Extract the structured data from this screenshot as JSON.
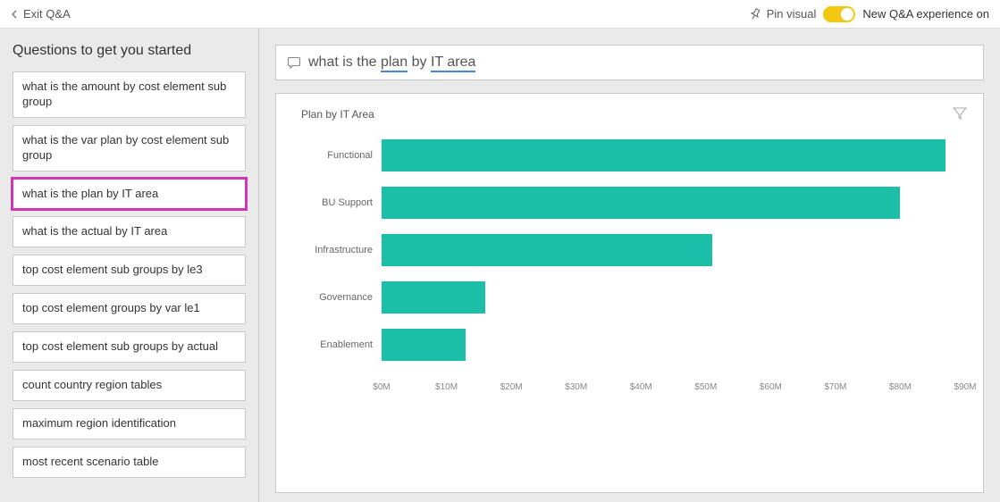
{
  "topbar": {
    "exit_label": "Exit Q&A",
    "pin_label": "Pin visual",
    "toggle_label": "New Q&A experience on"
  },
  "sidebar": {
    "title": "Questions to get you started",
    "questions": [
      {
        "text": "what is the amount by cost element sub group",
        "selected": false
      },
      {
        "text": "what is the var plan by cost element sub group",
        "selected": false
      },
      {
        "text": "what is the plan by IT area",
        "selected": true
      },
      {
        "text": "what is the actual by IT area",
        "selected": false
      },
      {
        "text": "top cost element sub groups by le3",
        "selected": false
      },
      {
        "text": "top cost element groups by var le1",
        "selected": false
      },
      {
        "text": "top cost element sub groups by actual",
        "selected": false
      },
      {
        "text": "count country region tables",
        "selected": false
      },
      {
        "text": "maximum region identification",
        "selected": false
      },
      {
        "text": "most recent scenario table",
        "selected": false
      }
    ]
  },
  "query": {
    "prefix": "what is the ",
    "u1": "plan",
    "mid": " by ",
    "u2": "IT area"
  },
  "chart_data": {
    "type": "bar",
    "title": "Plan by IT Area",
    "xlabel": "",
    "ylabel": "",
    "xlim": [
      0,
      90
    ],
    "categories": [
      "Functional",
      "BU Support",
      "Infrastructure",
      "Governance",
      "Enablement"
    ],
    "values": [
      87,
      80,
      51,
      16,
      13
    ],
    "ticks": [
      0,
      10,
      20,
      30,
      40,
      50,
      60,
      70,
      80,
      90
    ],
    "tick_labels": [
      "$0M",
      "$10M",
      "$20M",
      "$30M",
      "$40M",
      "$50M",
      "$60M",
      "$70M",
      "$80M",
      "$90M"
    ]
  }
}
